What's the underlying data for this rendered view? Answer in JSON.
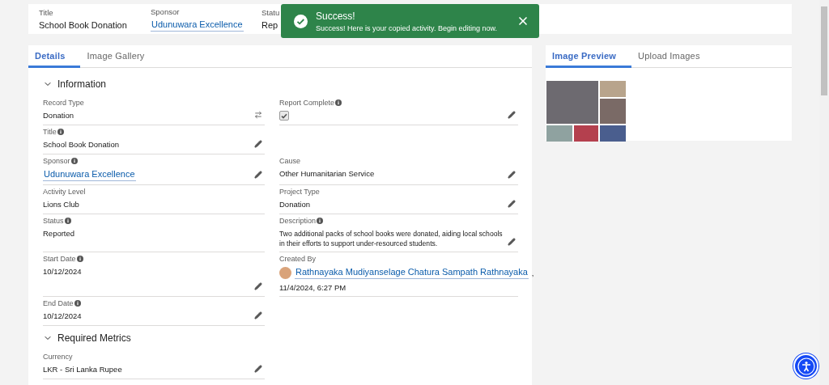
{
  "header": {
    "fields": [
      {
        "label": "Title",
        "value": "School Book Donation",
        "kind": "text"
      },
      {
        "label": "Sponsor",
        "value": "Udunuwara Excellence",
        "kind": "link"
      },
      {
        "label": "Statu",
        "value": "Rep",
        "kind": "text"
      }
    ]
  },
  "toast": {
    "title": "Success!",
    "message": "Success! Here is your copied activity. Begin editing now."
  },
  "main_tabs": [
    {
      "label": "Details",
      "selected": true
    },
    {
      "label": "Image Gallery",
      "selected": false
    }
  ],
  "sections": [
    {
      "title": "Information",
      "expanded": true,
      "rows": [
        [
          {
            "label": "Record Type",
            "info": false,
            "kind": "text",
            "value": "Donation",
            "editable": false,
            "switchable": true
          },
          {
            "label": "Report Complete",
            "info": true,
            "kind": "checkbox",
            "checked": true,
            "editable": true,
            "switchable": false
          }
        ],
        [
          {
            "label": "Title",
            "info": true,
            "kind": "text",
            "value": "School Book Donation",
            "editable": true,
            "switchable": false
          },
          {
            "kind": "empty"
          }
        ],
        [
          {
            "label": "Sponsor",
            "info": true,
            "kind": "link",
            "value": "Udunuwara Excellence",
            "editable": true,
            "switchable": false
          },
          {
            "label": "Cause",
            "info": false,
            "kind": "text",
            "value": "Other Humanitarian Service",
            "editable": true,
            "switchable": false
          }
        ],
        [
          {
            "label": "Activity Level",
            "info": false,
            "kind": "text",
            "value": "Lions Club",
            "editable": false,
            "switchable": false
          },
          {
            "label": "Project Type",
            "info": false,
            "kind": "text",
            "value": "Donation",
            "editable": true,
            "switchable": false
          }
        ],
        [
          {
            "label": "Status",
            "info": true,
            "kind": "text",
            "value": "Reported",
            "editable": false,
            "switchable": false
          },
          {
            "label": "Description",
            "info": true,
            "kind": "text",
            "value": "Two additional packs of school books were donated, aiding local schools in their efforts to support under-resourced students.",
            "editable": true,
            "switchable": false
          }
        ],
        [
          {
            "label": "Start Date",
            "info": true,
            "kind": "text",
            "value": "10/12/2024",
            "editable": true,
            "switchable": false
          },
          {
            "label": "Created By",
            "info": false,
            "kind": "user",
            "value": "Rathnayaka Mudiyanselage Chatura Sampath Rathnayaka",
            "separator": ",",
            "date": "11/4/2024, 6:27 PM",
            "editable": false,
            "switchable": false
          }
        ],
        [
          {
            "label": "End Date",
            "info": true,
            "kind": "text",
            "value": "10/12/2024",
            "editable": true,
            "switchable": false
          },
          {
            "kind": "empty"
          }
        ]
      ]
    },
    {
      "title": "Required Metrics",
      "expanded": true,
      "rows": [
        [
          {
            "label": "Currency",
            "info": false,
            "kind": "text",
            "value": "LKR - Sri Lanka Rupee",
            "editable": true,
            "switchable": false
          },
          {
            "kind": "empty"
          }
        ]
      ]
    }
  ],
  "side_tabs": [
    {
      "label": "Image Preview",
      "selected": true
    },
    {
      "label": "Upload Images",
      "selected": false
    }
  ]
}
